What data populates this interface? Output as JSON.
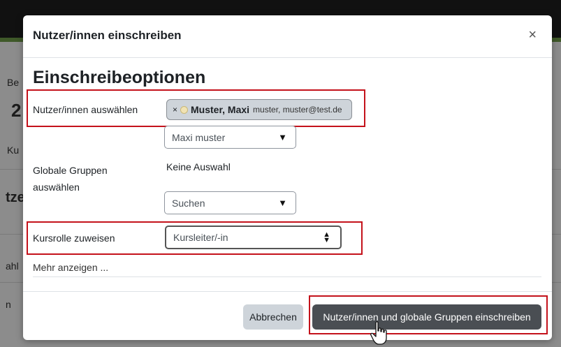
{
  "background": {
    "fragments": [
      "Be",
      "2",
      "Ku",
      "tze",
      "ahl",
      "n"
    ]
  },
  "modal": {
    "title": "Nutzer/innen einschreiben",
    "close_glyph": "×",
    "section_heading": "Einschreibeoptionen",
    "users": {
      "label": "Nutzer/innen auswählen",
      "chip_remove": "×",
      "chip_name": "Muster, Maxi",
      "chip_sub": "muster, muster@test.de",
      "search_value": "Maxi muster"
    },
    "groups": {
      "label_line1": "Globale Gruppen",
      "label_line2": "auswählen",
      "selection": "Keine Auswahl",
      "search_placeholder": "Suchen"
    },
    "role": {
      "label": "Kursrolle zuweisen",
      "value": "Kursleiter/-in"
    },
    "more_link": "Mehr anzeigen ...",
    "footer": {
      "cancel_label": "Abbrechen",
      "submit_label": "Nutzer/innen und globale Gruppen einschreiben"
    }
  },
  "colors": {
    "highlight": "#c4121b",
    "primary_button": "#4a4e53",
    "topbar": "#1f1f1f",
    "accent_green": "#74a34b"
  }
}
